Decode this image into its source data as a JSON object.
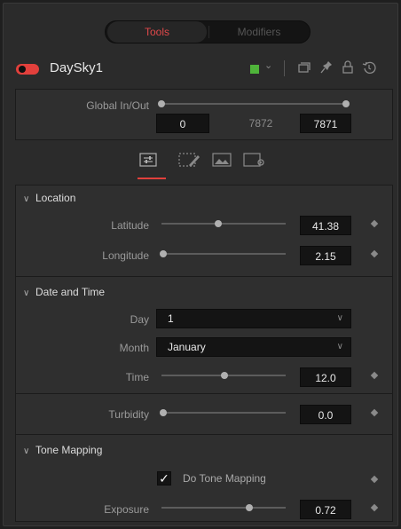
{
  "tabs": {
    "active": "Tools",
    "inactive": "Modifiers"
  },
  "node": {
    "name": "DaySky1",
    "color": "#4fb43a"
  },
  "global": {
    "label": "Global In/Out",
    "in_value": "0",
    "mid_value": "7872",
    "out_value": "7871"
  },
  "sections": {
    "location": "Location",
    "date_time": "Date and Time",
    "tone_mapping": "Tone Mapping"
  },
  "controls": {
    "latitude": {
      "label": "Latitude",
      "value": "41.38",
      "position": 0.43
    },
    "longitude": {
      "label": "Longitude",
      "value": "2.15",
      "position": 0.02
    },
    "day": {
      "label": "Day",
      "value": "1"
    },
    "month": {
      "label": "Month",
      "value": "January"
    },
    "time": {
      "label": "Time",
      "value": "12.0",
      "position": 0.5
    },
    "turbidity": {
      "label": "Turbidity",
      "value": "0.0",
      "position": 0.02
    },
    "do_tone_mapping": {
      "label": "Do Tone Mapping",
      "checked": "✓"
    },
    "exposure": {
      "label": "Exposure",
      "value": "0.72",
      "position": 0.72
    }
  }
}
